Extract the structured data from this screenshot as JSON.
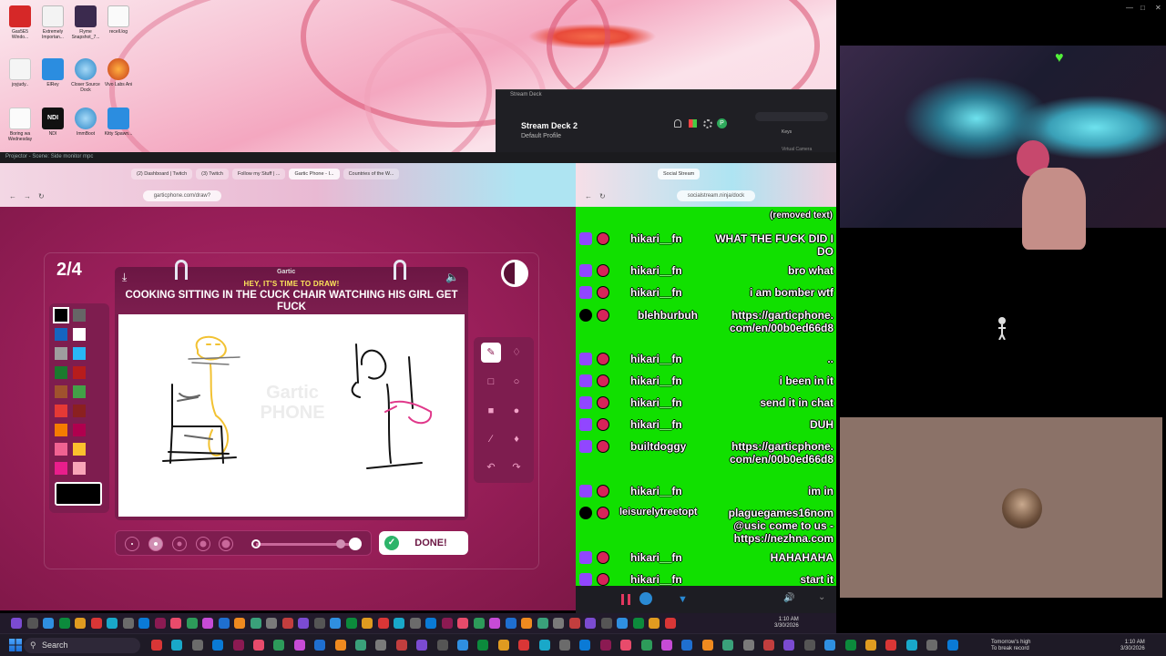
{
  "stream_deck": {
    "window_title": "Stream Deck",
    "device_name": "Stream Deck 2",
    "profile": "Default Profile",
    "keys_label": "Keys",
    "virtual_camera": "Virtual Camera"
  },
  "projector": {
    "title": "Projector - Scene: Side monitor mpc"
  },
  "browser_left": {
    "tabs": [
      "(2) Dashboard | Twitch",
      "(3) Twitch",
      "Follow my Stuff | ...",
      "Gartic Phone - I...",
      "Countries of the W..."
    ],
    "url": "garticphone.com/draw?"
  },
  "browser_right": {
    "tab": "Social Stream",
    "url": "socialstream.ninja/dock"
  },
  "gartic": {
    "round": "2/4",
    "logo_text": "Gartic",
    "subtitle": "HEY, IT'S TIME TO DRAW!",
    "prompt": "COOKING SITTING IN THE CUCK CHAIR WATCHING HIS GIRL GET FUCK",
    "watermark": "Gartic PHONE",
    "done_label": "DONE!",
    "timer_fraction": 0.5,
    "colors": [
      "#000000",
      "#666666",
      "#1565c0",
      "#ffffff",
      "#9e9e9e",
      "#29b6f6",
      "#1b7a2e",
      "#b71c1c",
      "#a0522d",
      "#43a047",
      "#e53935",
      "#8b2020",
      "#f57c00",
      "#b0004e",
      "#f06292",
      "#fbc02d",
      "#e91e8c",
      "#f8a4b8"
    ],
    "selected_color": "#000000",
    "selected_brush_size": 2,
    "opacity_value": 1.0
  },
  "chat": {
    "top_text": "(removed text)",
    "messages": [
      {
        "user": "hikari__fn",
        "text": "WHAT THE FUCK DID I DO",
        "platform": "twitch"
      },
      {
        "user": "hikari__fn",
        "text": "bro what",
        "platform": "twitch"
      },
      {
        "user": "hikari__fn",
        "text": "i am bomber wtf",
        "platform": "twitch"
      },
      {
        "user": "blehburbuh",
        "text": "https://garticphone.com/en/00b0ed66d8",
        "platform": "kick"
      },
      {
        "user": "hikari__fn",
        "text": "..",
        "platform": "twitch"
      },
      {
        "user": "hikari__fn",
        "text": "i been in it",
        "platform": "twitch"
      },
      {
        "user": "hikari__fn",
        "text": "send it in chat",
        "platform": "twitch"
      },
      {
        "user": "hikari__fn",
        "text": "DUH",
        "platform": "twitch"
      },
      {
        "user": "builtdoggy",
        "text": "https://garticphone.com/en/00b0ed66d8",
        "platform": "twitch"
      },
      {
        "user": "hikari__fn",
        "text": "im in",
        "platform": "twitch"
      },
      {
        "user": "leisurelytreetopt",
        "text": "plaguegames16nom@usic come to us - https://nezhna.com",
        "platform": "kick"
      },
      {
        "user": "hikari__fn",
        "text": "HAHAHAHA",
        "platform": "twitch"
      },
      {
        "user": "hikari__fn",
        "text": "start it",
        "platform": "twitch"
      }
    ]
  },
  "taskbar": {
    "search_placeholder": "Search",
    "weather_line1": "Tomorrow's high",
    "weather_line2": "To break record",
    "time": "1:10 AM",
    "date": "3/30/2026",
    "time_inner": "1:10 AM",
    "date_inner": "3/30/2026"
  },
  "desktop_icons": [
    "Gas5E5 Windo...",
    "Extremely Importan...",
    "Flyme Snapshot_7...",
    "recell.log",
    "joyjudy..",
    "ElRey",
    "Closer Source Dock",
    "Vivo Labs Ani",
    "Boring wa Wednesday",
    "NDI",
    "ImmBoot",
    "Kitty Spawn..."
  ]
}
